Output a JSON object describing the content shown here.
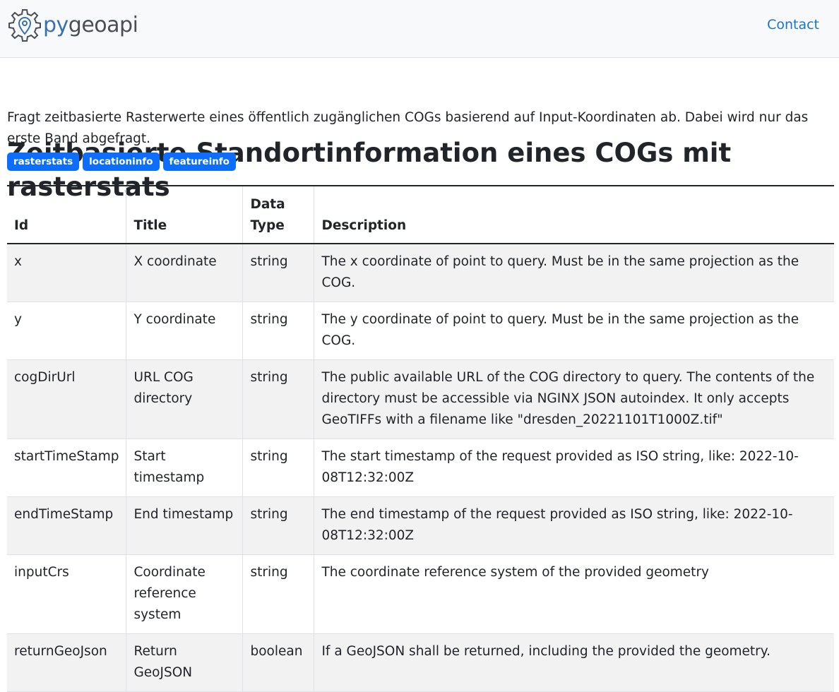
{
  "navbar": {
    "brand_prefix": "py",
    "brand_suffix": "geoapi",
    "contact_label": "Contact"
  },
  "process": {
    "title": "Zeitbasierte Standortinformation eines COGs mit rasterstats",
    "description": "Fragt zeitbasierte Rasterwerte eines öffentlich zugänglichen COGs basierend auf Input-Koordinaten ab. Dabei wird nur das erste Band abgefragt.",
    "keywords": [
      "rasterstats",
      "locationinfo",
      "featureinfo"
    ]
  },
  "table": {
    "headers": {
      "id": "Id",
      "title": "Title",
      "data_type": "Data Type",
      "description": "Description"
    },
    "rows": [
      {
        "id": "x",
        "title": "X coordinate",
        "data_type": "string",
        "description": "The x coordinate of point to query. Must be in the same projection as the COG."
      },
      {
        "id": "y",
        "title": "Y coordinate",
        "data_type": "string",
        "description": "The y coordinate of point to query. Must be in the same projection as the COG."
      },
      {
        "id": "cogDirUrl",
        "title": "URL COG directory",
        "data_type": "string",
        "description": "The public available URL of the COG directory to query. The contents of the directory must be accessible via NGINX JSON autoindex. It only accepts GeoTIFFs with a filename like \"dresden_20221101T1000Z.tif\""
      },
      {
        "id": "startTimeStamp",
        "title": "Start timestamp",
        "data_type": "string",
        "description": "The start timestamp of the request provided as ISO string, like: 2022-10-08T12:32:00Z"
      },
      {
        "id": "endTimeStamp",
        "title": "End timestamp",
        "data_type": "string",
        "description": "The end timestamp of the request provided as ISO string, like: 2022-10-08T12:32:00Z"
      },
      {
        "id": "inputCrs",
        "title": "Coordinate reference system",
        "data_type": "string",
        "description": "The coordinate reference system of the provided geometry"
      },
      {
        "id": "returnGeoJson",
        "title": "Return GeoJSON",
        "data_type": "boolean",
        "description": "If a GeoJSON shall be returned, including the provided the geometry."
      }
    ]
  },
  "colors": {
    "badge": "#0d6efd",
    "link": "#1a73c9",
    "navbar_bg": "#f8f9fa",
    "brand_py": "#3a6fb0"
  },
  "icons": {
    "brand_logo": "gear-location-pin-icon"
  }
}
